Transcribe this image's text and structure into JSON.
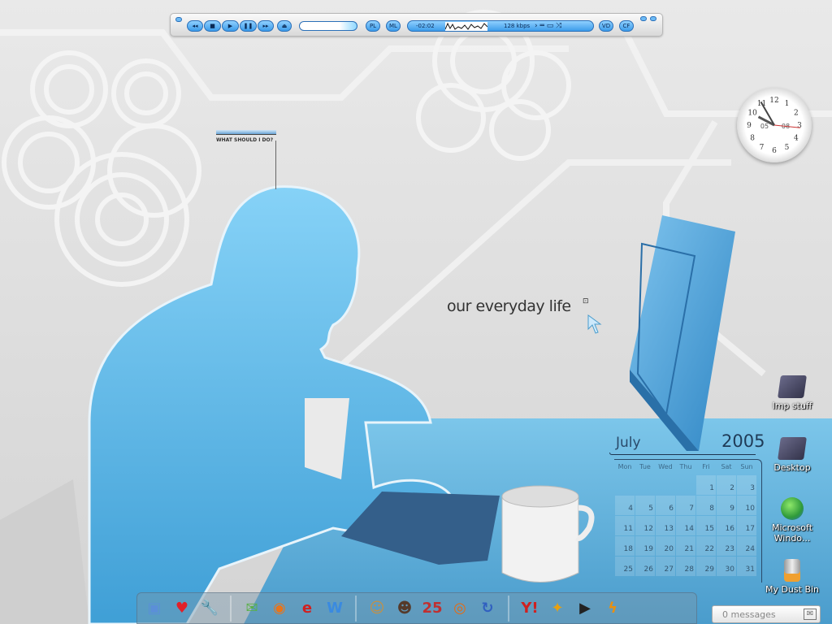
{
  "player": {
    "buttons": {
      "prev": "◂◂",
      "stop": "■",
      "play": "▶",
      "pause": "❚❚",
      "next": "▸▸",
      "eject": "⏏",
      "pl": "PL",
      "ml": "ML",
      "vd": "VD",
      "cf": "CF"
    },
    "time": "-02:02",
    "bitrate": "128 kbps",
    "seek_progress": 0.95
  },
  "widget": {
    "what_should_i_do": "WHAT SHOULD I DO?"
  },
  "wallpaper": {
    "tagline": "our everyday life"
  },
  "clock": {
    "hour": 9,
    "minute": 55,
    "date_left": "05",
    "date_right": "08",
    "numerals": [
      "12",
      "1",
      "2",
      "3",
      "4",
      "5",
      "6",
      "7",
      "8",
      "9",
      "10",
      "11"
    ]
  },
  "calendar": {
    "month": "July",
    "year": "2005",
    "days_of_week": [
      "Mon",
      "Tue",
      "Wed",
      "Thu",
      "Fri",
      "Sat",
      "Sun"
    ],
    "first_weekday_index": 4,
    "days": [
      "1",
      "2",
      "3",
      "4",
      "5",
      "6",
      "7",
      "8",
      "9",
      "10",
      "11",
      "12",
      "13",
      "14",
      "15",
      "16",
      "17",
      "18",
      "19",
      "20",
      "21",
      "22",
      "23",
      "24",
      "25",
      "26",
      "27",
      "28",
      "29",
      "30",
      "31"
    ]
  },
  "desktop_icons": [
    {
      "label": "Imp stuff",
      "icon": "folder-icon"
    },
    {
      "label": "Desktop",
      "icon": "folder-icon"
    },
    {
      "label": "Microsoft Windo...",
      "icon": "globe-icon"
    },
    {
      "label": "My Dust Bin",
      "icon": "recycle-bin-icon"
    }
  ],
  "dock": {
    "groups": [
      [
        {
          "name": "display-settings",
          "glyph": "▣",
          "color": "#5b8fd8"
        },
        {
          "name": "favorites",
          "glyph": "♥",
          "color": "#e0202a"
        },
        {
          "name": "tools",
          "glyph": "🔧",
          "color": "#aaa"
        }
      ],
      [
        {
          "name": "messenger",
          "glyph": "✉",
          "color": "#5ab04a"
        },
        {
          "name": "firefox",
          "glyph": "◉",
          "color": "#e8741a"
        },
        {
          "name": "internet-explorer",
          "glyph": "e",
          "color": "#d02020"
        },
        {
          "name": "word",
          "glyph": "W",
          "color": "#3a8ae0"
        }
      ],
      [
        {
          "name": "user-accounts",
          "glyph": "☺",
          "color": "#c89040"
        },
        {
          "name": "contact",
          "glyph": "☻",
          "color": "#553a2a"
        },
        {
          "name": "calendar-app",
          "glyph": "25",
          "color": "#c03030"
        },
        {
          "name": "cd-burner",
          "glyph": "◎",
          "color": "#e86a10"
        },
        {
          "name": "sync",
          "glyph": "↻",
          "color": "#3060c0"
        }
      ],
      [
        {
          "name": "yahoo-messenger",
          "glyph": "Y!",
          "color": "#d02020"
        },
        {
          "name": "aim",
          "glyph": "✦",
          "color": "#e8a010"
        },
        {
          "name": "media-player",
          "glyph": "▶",
          "color": "#222"
        },
        {
          "name": "winamp",
          "glyph": "ϟ",
          "color": "#e89010"
        }
      ]
    ]
  },
  "messages": {
    "label": "0 messages"
  },
  "colors": {
    "accent": "#4aa3dc",
    "silhouette": "#5fb3e3"
  }
}
